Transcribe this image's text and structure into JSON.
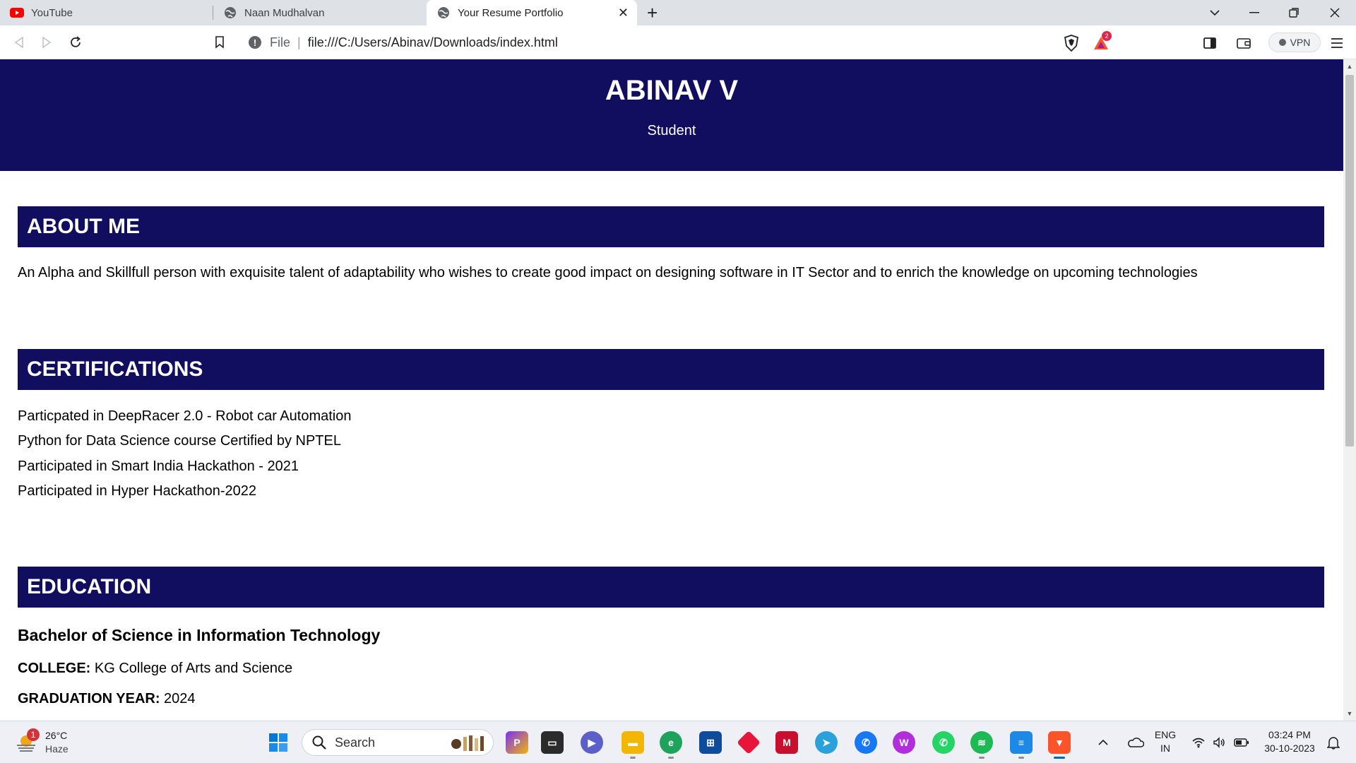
{
  "browser": {
    "tabs": [
      {
        "title": "YouTube",
        "icon": "youtube-icon"
      },
      {
        "title": "Naan Mudhalvan",
        "icon": "globe-icon"
      },
      {
        "title": "Your Resume Portfolio",
        "icon": "globe-icon"
      }
    ],
    "address": {
      "scheme_label": "File",
      "url": "file:///C:/Users/Abinav/Downloads/index.html"
    },
    "vpn_label": "VPN",
    "shield_badge": "2"
  },
  "page": {
    "name": "ABINAV V",
    "role": "Student",
    "about": {
      "heading": "ABOUT ME",
      "text": "An Alpha and Skillfull person with exquisite talent of adaptability who wishes to create good impact on designing software in IT Sector and to enrich the knowledge on upcoming technologies"
    },
    "certifications": {
      "heading": "CERTIFICATIONS",
      "items": [
        "Particpated in DeepRacer 2.0 - Robot car Automation",
        "Python for Data Science course Certified by NPTEL",
        "Participated in Smart India Hackathon - 2021",
        "Participated in Hyper Hackathon-2022"
      ]
    },
    "education": {
      "heading": "EDUCATION",
      "degree": "Bachelor of Science in Information Technology",
      "college_label": "COLLEGE:",
      "college": "KG College of Arts and Science",
      "grad_label": "GRADUATION YEAR:",
      "grad_year": "2024"
    }
  },
  "taskbar": {
    "weather": {
      "temp": "26°C",
      "condition": "Haze",
      "badge": "1"
    },
    "search_placeholder": "Search",
    "language": {
      "line1": "ENG",
      "line2": "IN"
    },
    "clock": {
      "time": "03:24 PM",
      "date": "30-10-2023"
    }
  },
  "colors": {
    "header_bg": "#110e5f",
    "tabbar_bg": "#dee1e6",
    "taskbar_bg": "#eef0f6"
  }
}
